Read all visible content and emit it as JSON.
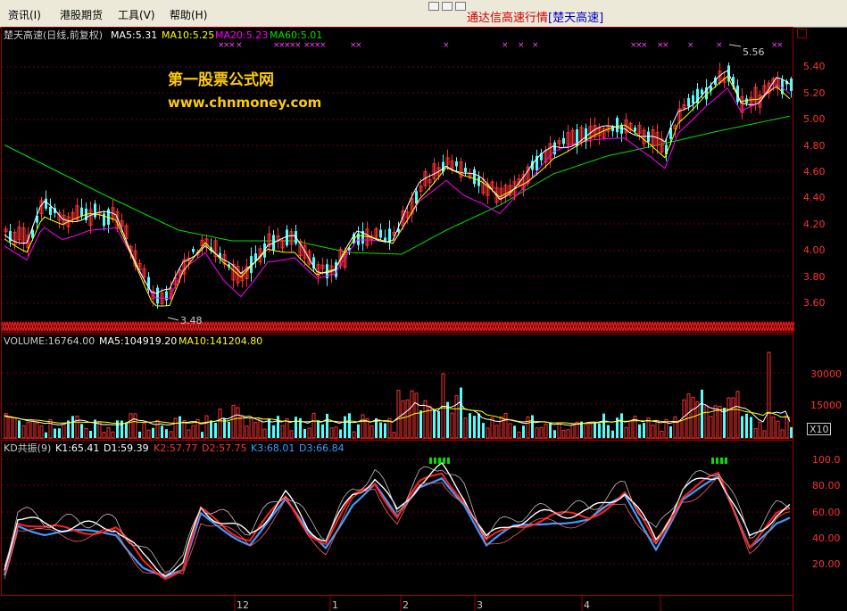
{
  "menu": {
    "items": [
      "资讯(I)",
      "港股期货",
      "工具(V)",
      "帮助(H)"
    ],
    "title_prefix": "通达信高速行情",
    "title_stock": "[楚天高速]"
  },
  "main_panel": {
    "stock_label": "楚天高速(日线,前复权)",
    "ma5": "MA5:5.31",
    "ma10": "MA10:5.25",
    "ma20": "MA20:5.23",
    "ma60": "MA60:5.01",
    "watermark_title": "第一股票公式网",
    "watermark_url": "www.chnmoney.com",
    "high_marker": "5.56",
    "low_marker": "3.48",
    "price_ticks": [
      "5.40",
      "5.20",
      "5.00",
      "4.80",
      "4.60",
      "4.40",
      "4.20",
      "4.00",
      "3.80",
      "3.60"
    ]
  },
  "volume_panel": {
    "volume": "VOLUME:16764.00",
    "ma5": "MA5:104919.20",
    "ma10": "MA10:141204.80",
    "ticks": [
      "30000",
      "15000"
    ],
    "unit": "X10"
  },
  "kd_panel": {
    "name": "KD共振(9)",
    "k1": "K1:65.41",
    "d1": "D1:59.39",
    "k2": "K2:57.77",
    "d2": "D2:57.75",
    "k3": "K3:68.01",
    "d3": "D3:66.84",
    "ticks": [
      "100.0",
      "80.00",
      "60.00",
      "40.00",
      "20.00"
    ]
  },
  "date_axis": [
    "12",
    "1",
    "2",
    "3",
    "4"
  ],
  "colors": {
    "up": "#ff3232",
    "down": "#54fcfc",
    "ma5": "#ffffff",
    "ma10": "#ffff00",
    "ma20": "#ff00ff",
    "ma60": "#00e000",
    "title_red": "#d00000",
    "title_blue": "#0000c0"
  }
}
